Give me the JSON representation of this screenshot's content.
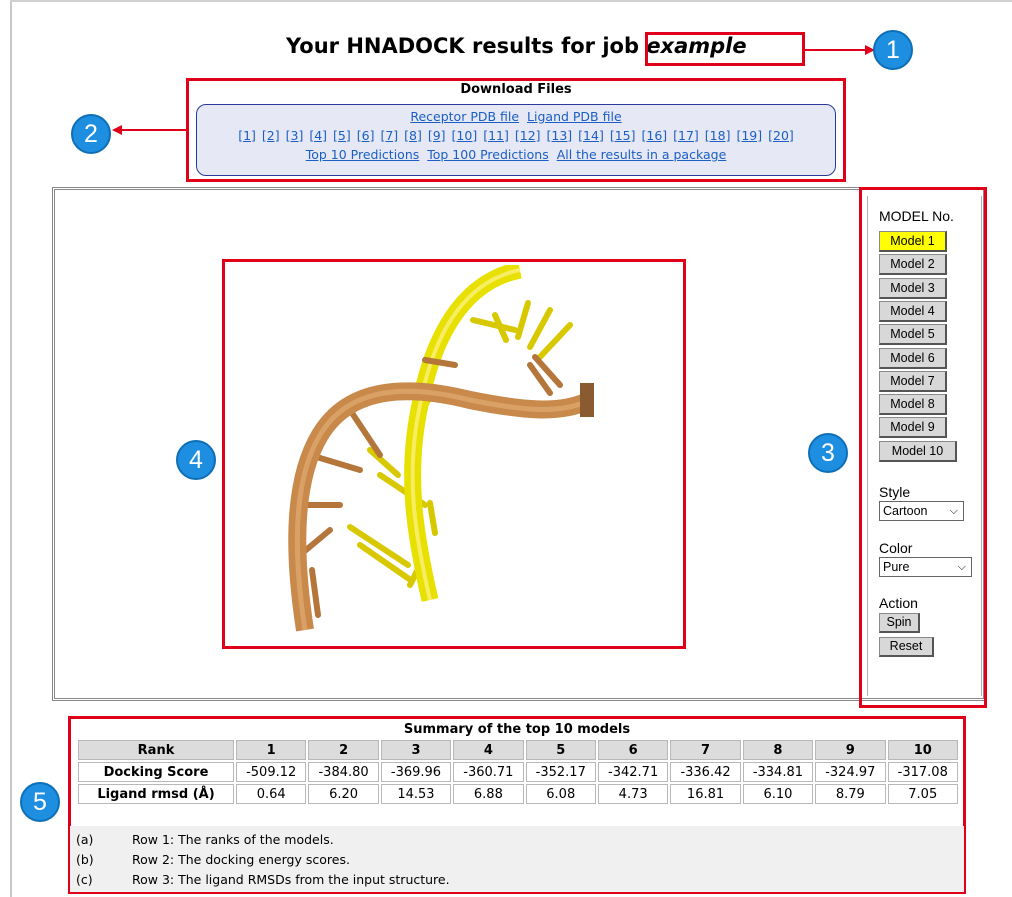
{
  "header": {
    "title_prefix": "Your HNADOCK results for job",
    "job_name": "example"
  },
  "callouts": [
    "1",
    "2",
    "3",
    "4",
    "5"
  ],
  "download": {
    "title": "Download Files",
    "receptor_link": "Receptor PDB file",
    "ligand_link": "Ligand PDB file",
    "model_links": [
      "[1]",
      "[2]",
      "[3]",
      "[4]",
      "[5]",
      "[6]",
      "[7]",
      "[8]",
      "[9]",
      "[10]",
      "[11]",
      "[12]",
      "[13]",
      "[14]",
      "[15]",
      "[16]",
      "[17]",
      "[18]",
      "[19]",
      "[20]"
    ],
    "top10_link": "Top 10 Predictions",
    "top100_link": "Top 100 Predictions",
    "package_link": "All the results in a package"
  },
  "panel": {
    "model_label": "MODEL No.",
    "models": [
      "Model 1",
      "Model 2",
      "Model 3",
      "Model 4",
      "Model 5",
      "Model 6",
      "Model 7",
      "Model 8",
      "Model 9",
      "Model 10"
    ],
    "active_model": "Model 1",
    "style_label": "Style",
    "style_value": "Cartoon",
    "color_label": "Color",
    "color_value": "Pure",
    "action_label": "Action",
    "spin_label": "Spin",
    "reset_label": "Reset"
  },
  "summary": {
    "title": "Summary of the top 10 models",
    "rank_label": "Rank",
    "ranks": [
      "1",
      "2",
      "3",
      "4",
      "5",
      "6",
      "7",
      "8",
      "9",
      "10"
    ],
    "docking_label": "Docking Score",
    "docking_scores": [
      "-509.12",
      "-384.80",
      "-369.96",
      "-360.71",
      "-352.17",
      "-342.71",
      "-336.42",
      "-334.81",
      "-324.97",
      "-317.08"
    ],
    "rmsd_label": "Ligand rmsd (Å)",
    "rmsds": [
      "0.64",
      "6.20",
      "14.53",
      "6.88",
      "6.08",
      "4.73",
      "16.81",
      "6.10",
      "8.79",
      "7.05"
    ],
    "notes": [
      {
        "label": "(a)",
        "text": "Row 1: The ranks of the models."
      },
      {
        "label": "(b)",
        "text": "Row 2: The docking energy scores."
      },
      {
        "label": "(c)",
        "text": "Row 3: The ligand RMSDs from the input structure."
      }
    ]
  },
  "colors": {
    "highlight_red": "#e0001a",
    "callout_blue": "#1e8fe0",
    "active_model": "#ffff00",
    "rna_strand_a": "#c8894a",
    "rna_strand_b": "#e8e000"
  }
}
